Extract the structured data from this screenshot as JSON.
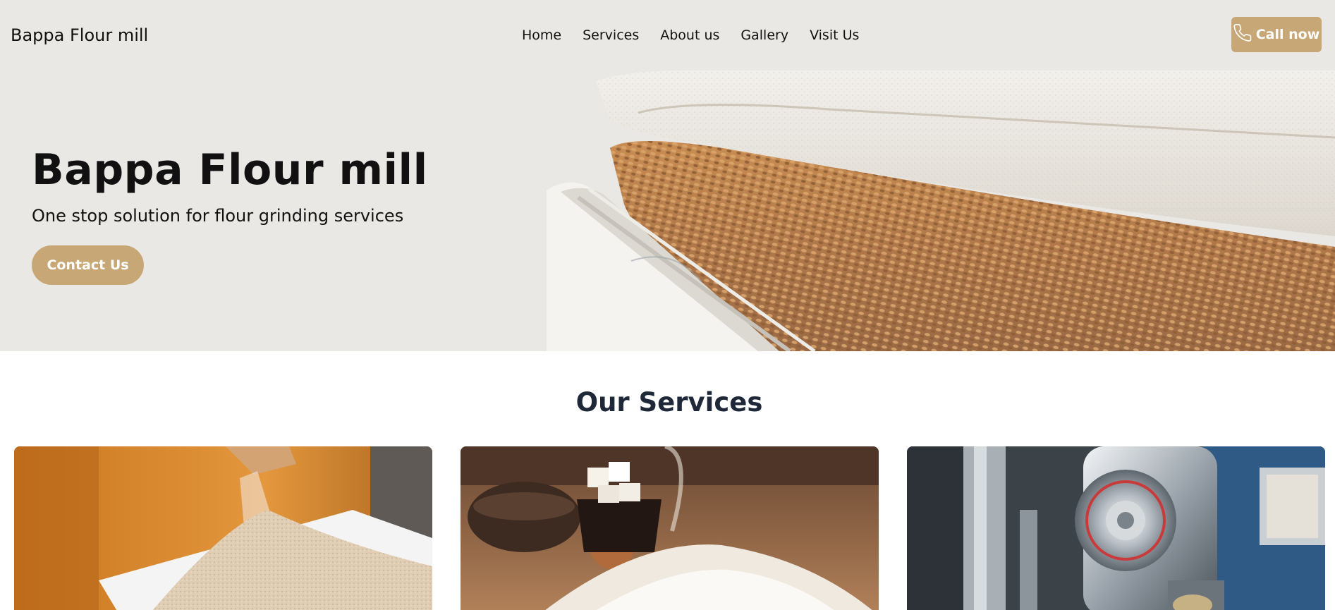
{
  "navbar": {
    "brand": "Bappa Flour mill",
    "links": [
      "Home",
      "Services",
      "About us",
      "Gallery",
      "Visit Us"
    ],
    "call_label": "Call now",
    "call_icon": "phone-icon"
  },
  "hero": {
    "title": "Bappa Flour mill",
    "subtitle": "One stop solution for flour grinding services",
    "cta_label": "Contact Us"
  },
  "services": {
    "title": "Our Services"
  },
  "colors": {
    "accent": "#c8a776",
    "header_bg": "#e9e8e4",
    "heading": "#1e2838"
  }
}
